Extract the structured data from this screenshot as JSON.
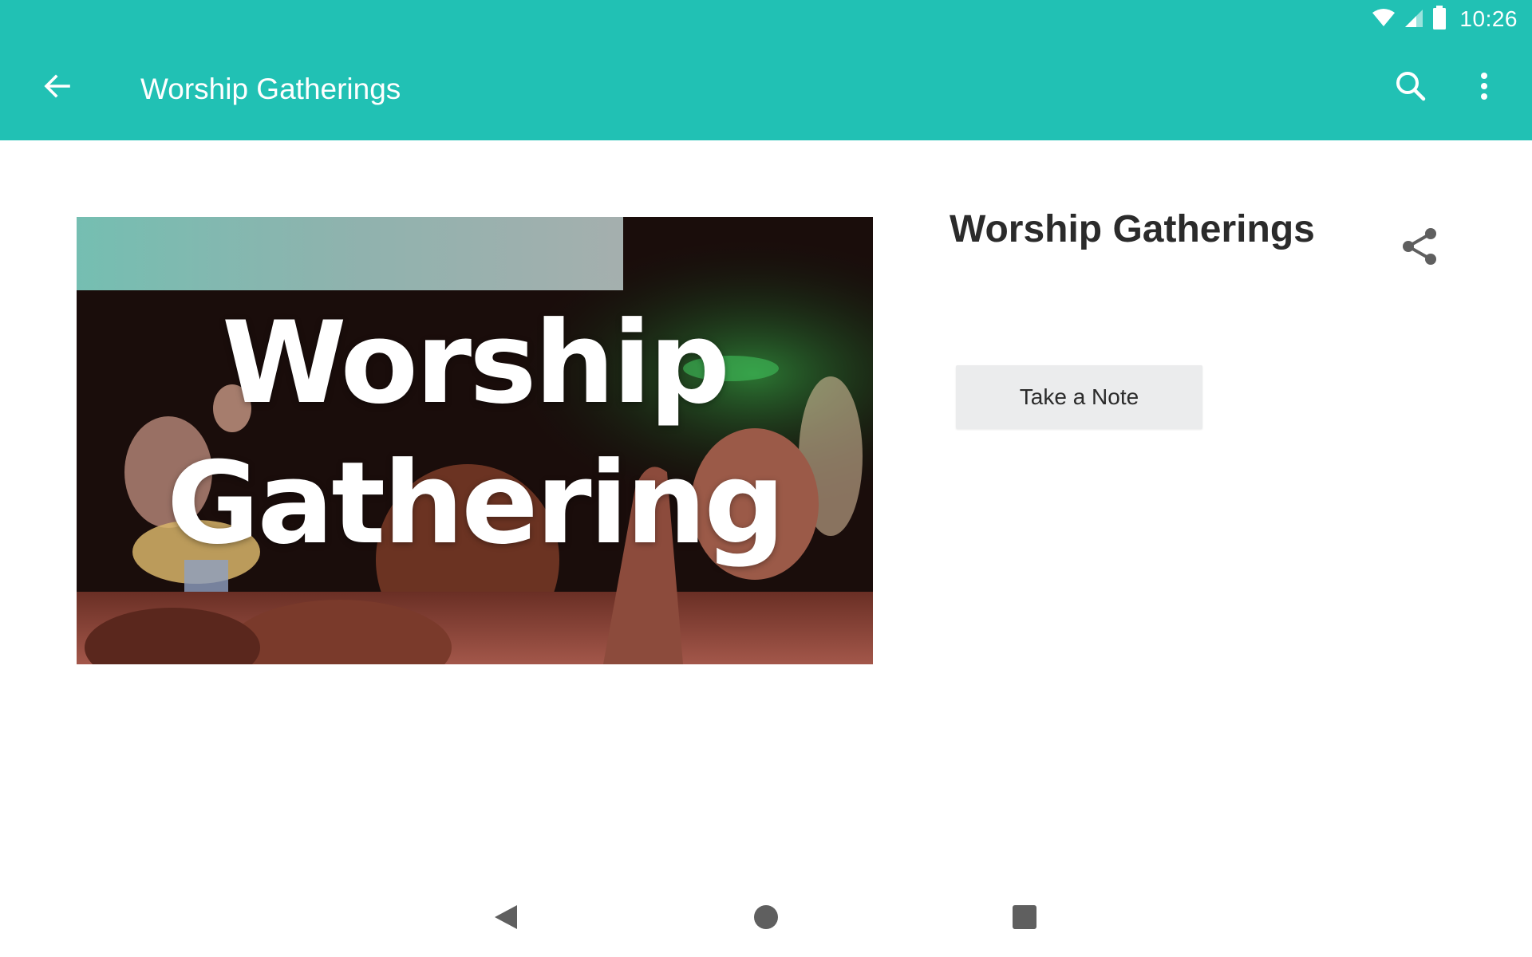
{
  "status_bar": {
    "time": "10:26",
    "icons": [
      "wifi-icon",
      "cell-signal-icon",
      "battery-icon"
    ]
  },
  "toolbar": {
    "title": "Worship Gatherings",
    "back_icon": "arrow-left-icon",
    "search_icon": "search-icon",
    "more_icon": "more-vert-icon"
  },
  "content": {
    "title": "Worship Gatherings",
    "share_icon": "share-icon",
    "image_caption": "Worship\nGathering",
    "note_button_label": "Take a Note"
  },
  "nav_bar": {
    "icons": [
      "nav-back-icon",
      "nav-home-icon",
      "nav-recents-icon"
    ]
  },
  "colors": {
    "accent": "#21c1b4",
    "title_text": "#2b2b2b",
    "button_bg": "#ebeced",
    "nav_icon": "#5f5f5f"
  }
}
